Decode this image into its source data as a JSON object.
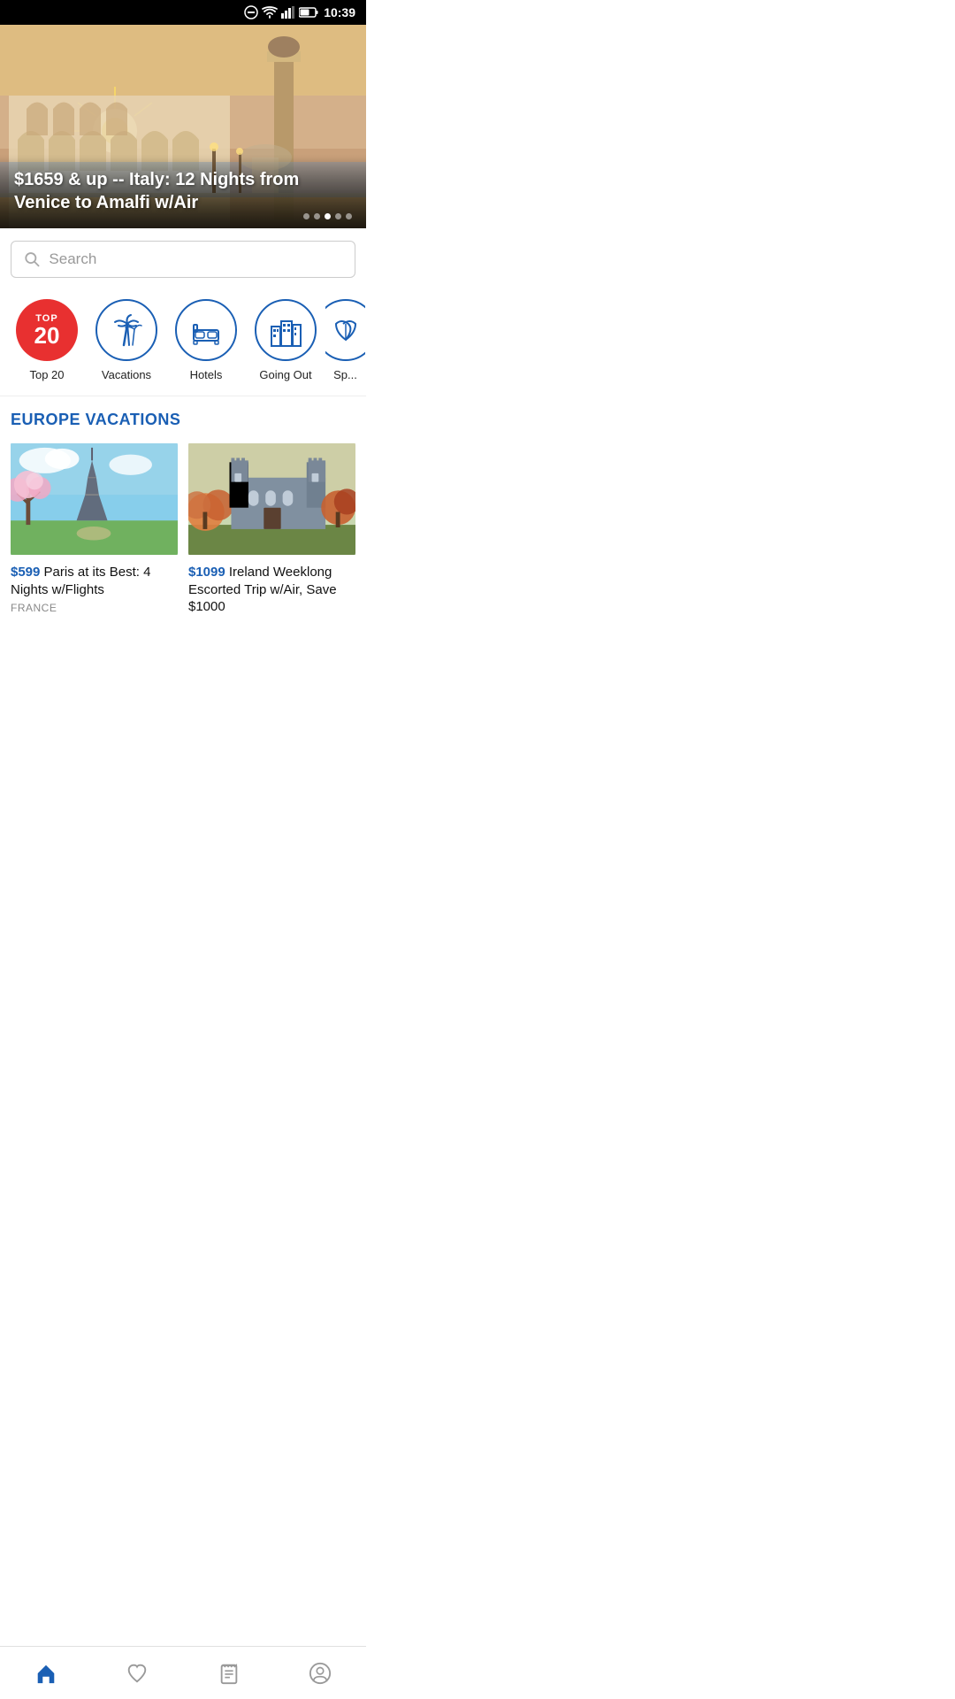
{
  "statusBar": {
    "time": "10:39"
  },
  "hero": {
    "text": "$1659 & up -- Italy: 12 Nights from Venice to Amalfi w/Air",
    "dots": [
      false,
      false,
      true,
      false,
      false
    ]
  },
  "search": {
    "placeholder": "Search"
  },
  "categories": [
    {
      "id": "top20",
      "label": "Top 20",
      "type": "top20"
    },
    {
      "id": "vacations",
      "label": "Vacations",
      "type": "outline",
      "icon": "palm"
    },
    {
      "id": "hotels",
      "label": "Hotels",
      "type": "outline",
      "icon": "hotel"
    },
    {
      "id": "going-out",
      "label": "Going Out",
      "type": "outline",
      "icon": "city"
    },
    {
      "id": "spa",
      "label": "Sp...",
      "type": "outline",
      "icon": "spa"
    }
  ],
  "sectionTitle": "EUROPE VACATIONS",
  "cards": [
    {
      "id": "paris",
      "price": "$599",
      "description": " Paris at its Best: 4 Nights w/Flights",
      "location": "FRANCE",
      "imageType": "paris"
    },
    {
      "id": "ireland",
      "price": "$1099",
      "description": " Ireland Weeklong Escorted Trip w/Air, Save $1000",
      "location": "",
      "imageType": "ireland"
    }
  ],
  "bottomNav": [
    {
      "id": "home",
      "label": "home",
      "active": true
    },
    {
      "id": "favorites",
      "label": "favorites",
      "active": false
    },
    {
      "id": "bookings",
      "label": "bookings",
      "active": false
    },
    {
      "id": "profile",
      "label": "profile",
      "active": false
    }
  ],
  "colors": {
    "blue": "#1a5fb4",
    "red": "#e83030",
    "activeNav": "#1a5fb4",
    "inactiveNav": "#999"
  }
}
